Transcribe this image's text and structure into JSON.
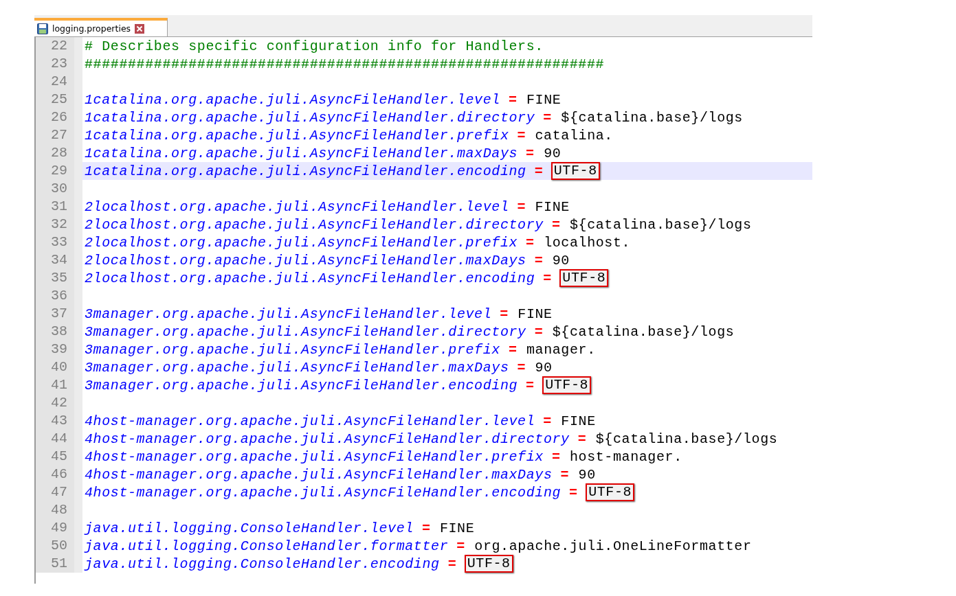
{
  "tab": {
    "title": "logging.properties",
    "selected": true
  },
  "lines": [
    {
      "number": "22",
      "kind": "comment",
      "text": "# Describes specific configuration info for Handlers.",
      "current": false
    },
    {
      "number": "23",
      "kind": "comment",
      "text": "############################################################",
      "current": false
    },
    {
      "number": "24",
      "kind": "blank",
      "current": false
    },
    {
      "number": "25",
      "kind": "property",
      "key": "1catalina.org.apache.juli.AsyncFileHandler.level",
      "operator": "=",
      "value": "FINE",
      "boxed": false,
      "current": false
    },
    {
      "number": "26",
      "kind": "property",
      "key": "1catalina.org.apache.juli.AsyncFileHandler.directory",
      "operator": "=",
      "value": "${catalina.base}/logs",
      "boxed": false,
      "current": false
    },
    {
      "number": "27",
      "kind": "property",
      "key": "1catalina.org.apache.juli.AsyncFileHandler.prefix",
      "operator": "=",
      "value": "catalina.",
      "boxed": false,
      "current": false
    },
    {
      "number": "28",
      "kind": "property",
      "key": "1catalina.org.apache.juli.AsyncFileHandler.maxDays",
      "operator": "=",
      "value": "90",
      "boxed": false,
      "current": false
    },
    {
      "number": "29",
      "kind": "property",
      "key": "1catalina.org.apache.juli.AsyncFileHandler.encoding",
      "operator": "=",
      "value": "UTF-8",
      "boxed": true,
      "current": true
    },
    {
      "number": "30",
      "kind": "blank",
      "current": false
    },
    {
      "number": "31",
      "kind": "property",
      "key": "2localhost.org.apache.juli.AsyncFileHandler.level",
      "operator": "=",
      "value": "FINE",
      "boxed": false,
      "current": false
    },
    {
      "number": "32",
      "kind": "property",
      "key": "2localhost.org.apache.juli.AsyncFileHandler.directory",
      "operator": "=",
      "value": "${catalina.base}/logs",
      "boxed": false,
      "current": false
    },
    {
      "number": "33",
      "kind": "property",
      "key": "2localhost.org.apache.juli.AsyncFileHandler.prefix",
      "operator": "=",
      "value": "localhost.",
      "boxed": false,
      "current": false
    },
    {
      "number": "34",
      "kind": "property",
      "key": "2localhost.org.apache.juli.AsyncFileHandler.maxDays",
      "operator": "=",
      "value": "90",
      "boxed": false,
      "current": false
    },
    {
      "number": "35",
      "kind": "property",
      "key": "2localhost.org.apache.juli.AsyncFileHandler.encoding",
      "operator": "=",
      "value": "UTF-8",
      "boxed": true,
      "current": false
    },
    {
      "number": "36",
      "kind": "blank",
      "current": false
    },
    {
      "number": "37",
      "kind": "property",
      "key": "3manager.org.apache.juli.AsyncFileHandler.level",
      "operator": "=",
      "value": "FINE",
      "boxed": false,
      "current": false
    },
    {
      "number": "38",
      "kind": "property",
      "key": "3manager.org.apache.juli.AsyncFileHandler.directory",
      "operator": "=",
      "value": "${catalina.base}/logs",
      "boxed": false,
      "current": false
    },
    {
      "number": "39",
      "kind": "property",
      "key": "3manager.org.apache.juli.AsyncFileHandler.prefix",
      "operator": "=",
      "value": "manager.",
      "boxed": false,
      "current": false
    },
    {
      "number": "40",
      "kind": "property",
      "key": "3manager.org.apache.juli.AsyncFileHandler.maxDays",
      "operator": "=",
      "value": "90",
      "boxed": false,
      "current": false
    },
    {
      "number": "41",
      "kind": "property",
      "key": "3manager.org.apache.juli.AsyncFileHandler.encoding",
      "operator": "=",
      "value": "UTF-8",
      "boxed": true,
      "current": false
    },
    {
      "number": "42",
      "kind": "blank",
      "current": false
    },
    {
      "number": "43",
      "kind": "property",
      "key": "4host-manager.org.apache.juli.AsyncFileHandler.level",
      "operator": "=",
      "value": "FINE",
      "boxed": false,
      "current": false
    },
    {
      "number": "44",
      "kind": "property",
      "key": "4host-manager.org.apache.juli.AsyncFileHandler.directory",
      "operator": "=",
      "value": "${catalina.base}/logs",
      "boxed": false,
      "current": false
    },
    {
      "number": "45",
      "kind": "property",
      "key": "4host-manager.org.apache.juli.AsyncFileHandler.prefix",
      "operator": "=",
      "value": "host-manager.",
      "boxed": false,
      "current": false
    },
    {
      "number": "46",
      "kind": "property",
      "key": "4host-manager.org.apache.juli.AsyncFileHandler.maxDays",
      "operator": "=",
      "value": "90",
      "boxed": false,
      "current": false
    },
    {
      "number": "47",
      "kind": "property",
      "key": "4host-manager.org.apache.juli.AsyncFileHandler.encoding",
      "operator": "=",
      "value": "UTF-8",
      "boxed": true,
      "current": false
    },
    {
      "number": "48",
      "kind": "blank",
      "current": false
    },
    {
      "number": "49",
      "kind": "property",
      "key": "java.util.logging.ConsoleHandler.level",
      "operator": "=",
      "value": "FINE",
      "boxed": false,
      "current": false
    },
    {
      "number": "50",
      "kind": "property",
      "key": "java.util.logging.ConsoleHandler.formatter",
      "operator": "=",
      "value": "org.apache.juli.OneLineFormatter",
      "boxed": false,
      "current": false
    },
    {
      "number": "51",
      "kind": "property",
      "key": "java.util.logging.ConsoleHandler.encoding",
      "operator": "=",
      "value": "UTF-8",
      "boxed": true,
      "current": false
    }
  ]
}
